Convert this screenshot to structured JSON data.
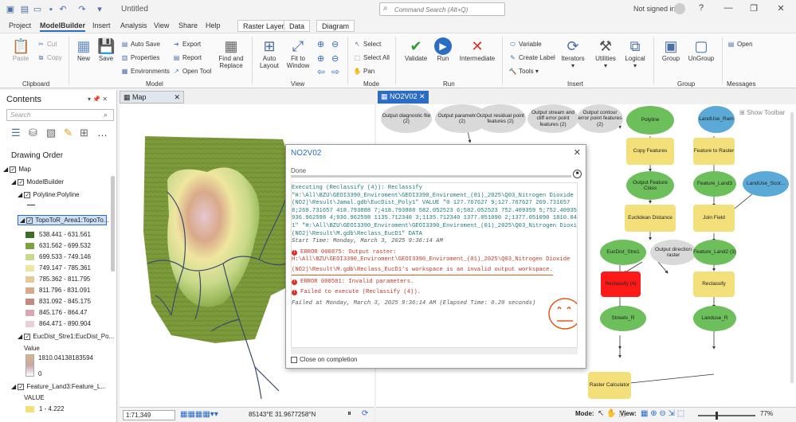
{
  "app": {
    "doc_title": "Untitled",
    "search_placeholder": "Command Search (Alt+Q)",
    "signin": "Not signed in",
    "winctl": [
      "?",
      "—",
      "❐",
      "✕"
    ]
  },
  "menu": [
    "Project",
    "ModelBuilder",
    "Insert",
    "Analysis",
    "View",
    "Share",
    "Help"
  ],
  "context_tabs": [
    "Raster Layer",
    "Data"
  ],
  "diagram_tab": "Diagram",
  "ribbon": {
    "clipboard": {
      "paste": "Paste",
      "cut": "Cut",
      "copy": "Copy",
      "group": "Clipboard"
    },
    "model": {
      "new": "New",
      "save": "Save",
      "autosave": "Auto Save",
      "properties": "Properties",
      "environments": "Environments",
      "export": "Export",
      "report": "Report",
      "open_tool": "Open Tool",
      "find_replace": "Find and Replace",
      "group": "Model"
    },
    "view": {
      "auto_layout": "Auto Layout",
      "fit_window": "Fit to Window",
      "group": "View"
    },
    "mode": {
      "select": "Select",
      "select_all": "Select All",
      "pan": "Pan",
      "group": "Mode"
    },
    "run": {
      "validate": "Validate",
      "run": "Run",
      "intermediate": "Intermediate",
      "group": "Run"
    },
    "insert": {
      "variable": "Variable",
      "create_label": "Create Label",
      "tools": "Tools",
      "iterators": "Iterators",
      "utilities": "Utilities",
      "logical": "Logical",
      "group": "Insert"
    },
    "group": {
      "group": "Group",
      "ungroup": "UnGroup",
      "label": "Group"
    },
    "messages": {
      "open": "Open",
      "label": "Messages"
    }
  },
  "contents": {
    "title": "Contents",
    "search": "Search",
    "drawing_order": "Drawing Order",
    "layers": {
      "map": "Map",
      "modelbuilder": "ModelBuilder",
      "polyline": "Polyline:Polyline",
      "topo": "TopoToR_Area1:TopoTo...",
      "eucdist": "EucDist_Stre1:EucDist_Po...",
      "value": "VALUE",
      "value2": "Value",
      "feature_land3": "Feature_Land3:Feature_L...",
      "value3": "VALUE"
    },
    "topo_classes": [
      {
        "label": "538.441 - 631.561",
        "color": "#3d6b2a"
      },
      {
        "label": "631.562 - 699.532",
        "color": "#7aa33a"
      },
      {
        "label": "699.533 - 749.146",
        "color": "#c8d98a"
      },
      {
        "label": "749.147 - 785.361",
        "color": "#efe6a0"
      },
      {
        "label": "785.362 - 811.795",
        "color": "#e8c89a"
      },
      {
        "label": "811.796 - 831.091",
        "color": "#d9a98a"
      },
      {
        "label": "831.092 - 845.175",
        "color": "#c58a7e"
      },
      {
        "label": "845.176 - 864.47",
        "color": "#d6a9b4"
      },
      {
        "label": "864.471 - 890.904",
        "color": "#e8d0d8"
      }
    ],
    "eucdist_high": "1810.04138183594",
    "eucdist_low": "0",
    "land3_first": "1 - 4.222"
  },
  "map_tab": "Map",
  "mb_tab": "NO2V02",
  "show_toolbar": "Show Toolbar",
  "map_status": {
    "scale": "1:71,349",
    "coords": "85143°E 31.9677258°N"
  },
  "mb_status": {
    "mode": "Mode:",
    "view": "View:",
    "zoom": "77%"
  },
  "dialog": {
    "title": "NO2V02",
    "status": "Done",
    "exec": [
      "Executing (Reclassify (4)): Reclassify",
      "\"H:\\All\\BZU\\GEOI3390_Enviroment\\GEOI3390_Enviroment_(01)_2025\\Q03_Nitrogen Dioxide",
      "(NO2)\\Result\\Jamal.gdb\\EucDist_Poly1\" VALUE \"0 127.767627 9;127.767627 269.731657",
      "8;269.731657 418.793888 7;418.793888 582.052523 6;582.052523 752.409359 5;752.409359",
      "936.962598 4;936.962598 1135.712340 3;1135.712340 1377.051090 2;1377.051090 1810.041382",
      "1\" \"H:\\All\\BZU\\GEOI3390_Enviroment\\GEOI3390_Enviroment_(01)_2025\\Q03_Nitrogen Dioxide",
      "(NO2)\\Result\\M.gdb\\Reclass_EucD1\" DATA"
    ],
    "start": "Start Time: Monday, March 3, 2025 9:36:14 AM",
    "err1": [
      "ERROR 000875: Output raster:",
      "H:\\All\\BZU\\GEOI3390_Enviroment\\GEOI3390_Enviroment_(01)_2025\\Q03_Nitrogen Dioxide",
      "(NO2)\\Result\\M.gdb\\Reclass_EucD1's workspace is an invalid output workspace."
    ],
    "err2": "ERROR 000581: Invalid parameters.",
    "err3": "Failed to execute (Reclassify (4)).",
    "failed": "Failed at Monday, March 3, 2025 9:36:14 AM (Elapsed Time: 0.20 seconds)",
    "close_on_completion": "Close on completion"
  },
  "nodes": {
    "out_diag": "Output diagnostic file (2)",
    "out_param": "Output parameter file (2)",
    "out_resid": "Output residual point features (2)",
    "out_stream": "Output stream and cliff error point features (2)",
    "out_contour": "Output contour error point features (2)",
    "polyline": "Polyline",
    "copy_features": "Copy Features",
    "out_feature_class": "Output Feature Class",
    "euclidean": "Euclidean Distance",
    "eucdist_stre1": "EucDist_Stre1",
    "out_dir_raster": "Output direction raster",
    "reclassify4": "Reclassify (4)",
    "streets_r": "Streets_R",
    "landuse_ram": "LandUse_Ram",
    "feature_to_raster": "Feature to Raster",
    "feature_land3": "Feature_Land3",
    "landuse_scor": "LandUse_Scor...",
    "join_field": "Join Field",
    "feature_land2": "Feature_Land2 (3)",
    "reclassify": "Reclassify",
    "landuse_r": "Landuse_R",
    "raster_calc": "Raster Calculator"
  },
  "colors": {
    "accent": "#2b6cc4",
    "node_green": "#6cbf5a",
    "node_yellow": "#f3e07a",
    "node_red": "#ff1a1a",
    "node_blue": "#5aa9d6",
    "node_grey": "#d9d9d9"
  }
}
